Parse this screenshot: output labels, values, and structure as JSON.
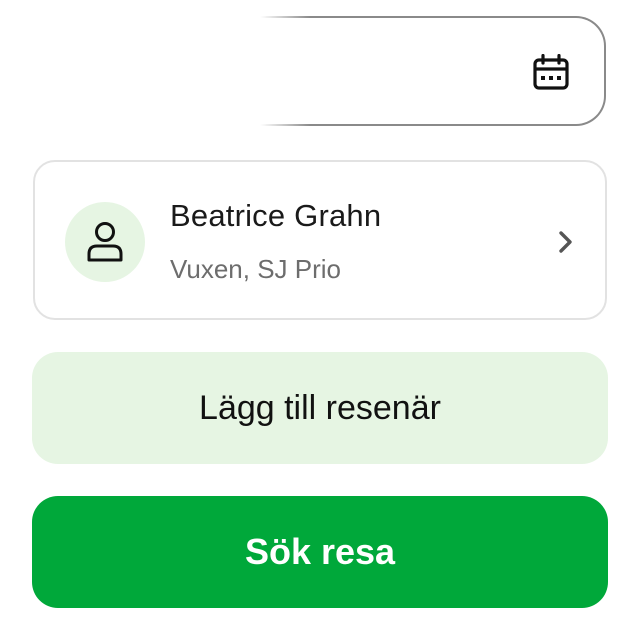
{
  "date_field": {
    "icon": "calendar-icon"
  },
  "traveler": {
    "name": "Beatrice Grahn",
    "details": "Vuxen, SJ Prio",
    "avatar_icon": "person-icon",
    "chevron_icon": "chevron-right-icon"
  },
  "actions": {
    "add_traveler_label": "Lägg till resenär",
    "search_label": "Sök resa"
  },
  "colors": {
    "primary_green": "#00a83a",
    "light_green": "#e6f5e3",
    "text_dark": "#111111",
    "text_muted": "#6d6d6d",
    "border": "#e2e2e2"
  }
}
